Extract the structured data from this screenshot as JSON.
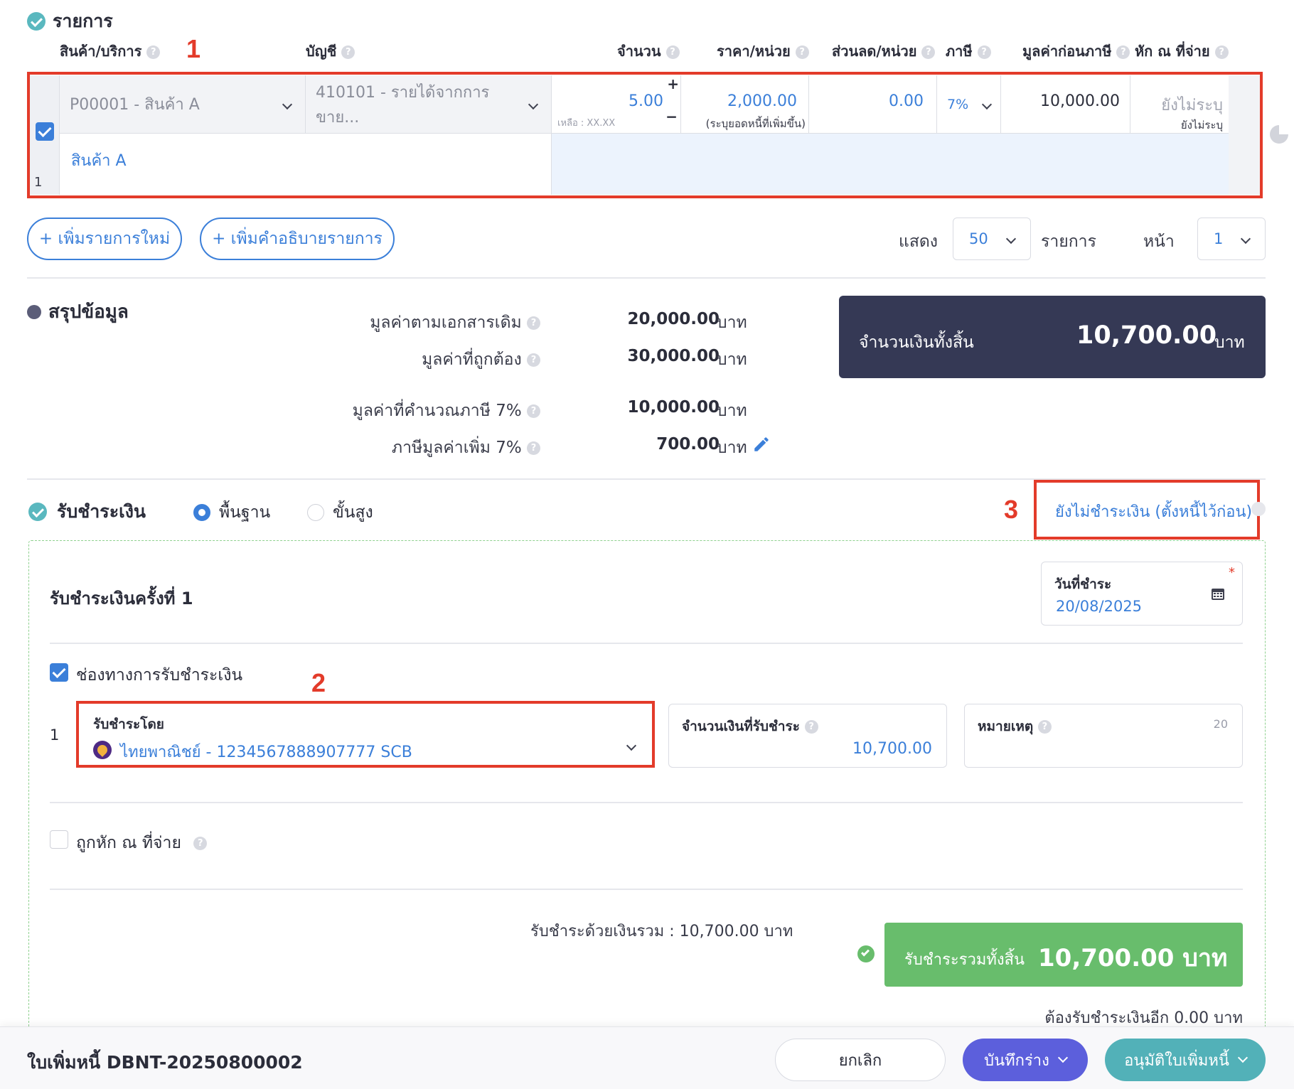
{
  "items_section": {
    "title": "รายการ",
    "columns": {
      "product": "สินค้า/บริการ",
      "account": "บัญชี",
      "qty": "จำนวน",
      "price": "ราคา/หน่วย",
      "discount": "ส่วนลด/หน่วย",
      "tax": "ภาษี",
      "pretax": "มูลค่าก่อนภาษี",
      "wht": "หัก ณ ที่จ่าย"
    },
    "row": {
      "index": "1",
      "product": "P00001 - สินค้า A",
      "account": "410101 - รายได้จากการขาย...",
      "qty": "5.00",
      "qty_plus": "+",
      "qty_minus": "−",
      "remaining": "เหลือ : XX.XX",
      "price": "2,000.00",
      "price_note": "(ระบุยอดหนี้ที่เพิ่มขึ้น)",
      "discount": "0.00",
      "tax": "7%",
      "pretax": "10,000.00",
      "wht": "ยังไม่ระบุ",
      "wht_sub": "ยังไม่ระบุ",
      "description": "สินค้า A"
    },
    "add_item": "+ เพิ่มรายการใหม่",
    "add_desc": "+ เพิ่มคำอธิบายรายการ",
    "show_label": "แสดง",
    "per_page": "50",
    "items_label": "รายการ",
    "page_label": "หน้า",
    "page": "1"
  },
  "annotations": {
    "one": "1",
    "two": "2",
    "three": "3"
  },
  "summary": {
    "title": "สรุปข้อมูล",
    "rows": [
      {
        "label": "มูลค่าตามเอกสารเดิม",
        "value": "20,000.00",
        "unit": "บาท"
      },
      {
        "label": "มูลค่าที่ถูกต้อง",
        "value": "30,000.00",
        "unit": "บาท"
      },
      {
        "label": "มูลค่าที่คำนวณภาษี 7%",
        "value": "10,000.00",
        "unit": "บาท"
      },
      {
        "label": "ภาษีมูลค่าเพิ่ม 7%",
        "value": "700.00",
        "unit": "บาท"
      }
    ],
    "total_label": "จำนวนเงินทั้งสิ้น",
    "total_value": "10,700.00",
    "total_unit": "บาท"
  },
  "payment": {
    "title": "รับชำระเงิน",
    "mode_basic": "พื้นฐาน",
    "mode_advanced": "ขั้นสูง",
    "unpaid_link": "ยังไม่ชำระเงิน (ตั้งหนี้ไว้ก่อน)",
    "round_title": "รับชำระเงินครั้งที่ 1",
    "date_label": "วันที่ชำระ",
    "date_value": "20/08/2025",
    "required_mark": "*",
    "channel_label": "ช่องทางการรับชำระเงิน",
    "line_index": "1",
    "pay_by_label": "รับชำระโดย",
    "pay_by_value": "ไทยพาณิชย์ - 1234567888907777 SCB",
    "amount_label": "จำนวนเงินที่รับชำระ",
    "amount_value": "10,700.00",
    "note_label": "หมายเหตุ",
    "note_count": "20",
    "wht_label": "ถูกหัก ณ ที่จ่าย",
    "total_text": "รับชำระด้วยเงินรวม : 10,700.00 บาท",
    "grand_label": "รับชำระรวมทั้งสิ้น",
    "grand_value": "10,700.00 บาท",
    "remaining": "ต้องรับชำระเงินอีก 0.00 บาท"
  },
  "footer": {
    "doc_title": "ใบเพิ่มหนี้ DBNT-20250800002",
    "cancel": "ยกเลิก",
    "save_draft": "บันทึกร่าง",
    "approve": "อนุมัติใบเพิ่มหนี้"
  },
  "colors": {
    "accent_blue": "#3b7fd9",
    "navy": "#353955",
    "green": "#68bd6c",
    "purple": "#5c5fdc",
    "teal": "#52b1b8",
    "annotation_red": "#e33b2a"
  }
}
